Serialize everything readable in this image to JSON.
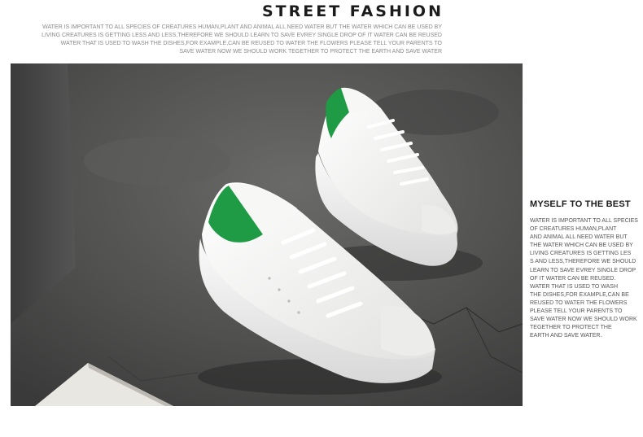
{
  "header": {
    "title": "STREET FASHION",
    "intro_lines": [
      "WATER IS IMPORTANT TO ALL SPECIES OF CREATURES HUMAN,PLANT AND ANIMAL  ALL NEED WATER BUT THE WATER WHICH CAN BE USED BY",
      "LIVING CREATURES IS GETTING LESS AND LESS,THEREFORE WE SHOULD LEARN TO SAVE EVREY SINGLE DROP OF IT WATER CAN BE REUSED",
      "WATER THAT IS USED TO WASH THE DISHES,FOR EXAMPLE,CAN BE REUSED TO WATER THE FLOWERS PLEASE TELL YOUR PARENTS TO",
      "SAVE WATER NOW WE SHOULD WORK TEGETHER TO PROTECT THE EARTH AND SAVE WATER"
    ]
  },
  "photo": {
    "subject": "white-green-sneakers-photo",
    "colors": {
      "heel_tab": "#1f9a45",
      "upper": "#f2f2f0",
      "ground": "#4a4a4a"
    }
  },
  "side": {
    "title": "MYSELF TO THE BEST",
    "body_lines": [
      "WATER IS IMPORTANT TO ALL SPECIES",
      "OF CREATURES HUMAN,PLANT",
      "AND ANIMAL  ALL NEED WATER BUT",
      " THE WATER WHICH CAN BE USED BY",
      " LIVING CREATURES IS GETTING LES",
      "S AND LESS,THEREFORE WE SHOULD",
      "LEARN TO SAVE EVREY SINGLE DROP",
      "OF IT WATER CAN BE REUSED.",
      "WATER THAT IS USED TO WASH",
      "THE DISHES,FOR EXAMPLE,CAN BE",
      "REUSED TO WATER THE FLOWERS",
      "PLEASE TELL YOUR PARENTS TO",
      "SAVE WATER NOW WE SHOULD WORK",
      "TEGETHER TO PROTECT THE",
      "EARTH AND SAVE WATER."
    ]
  }
}
